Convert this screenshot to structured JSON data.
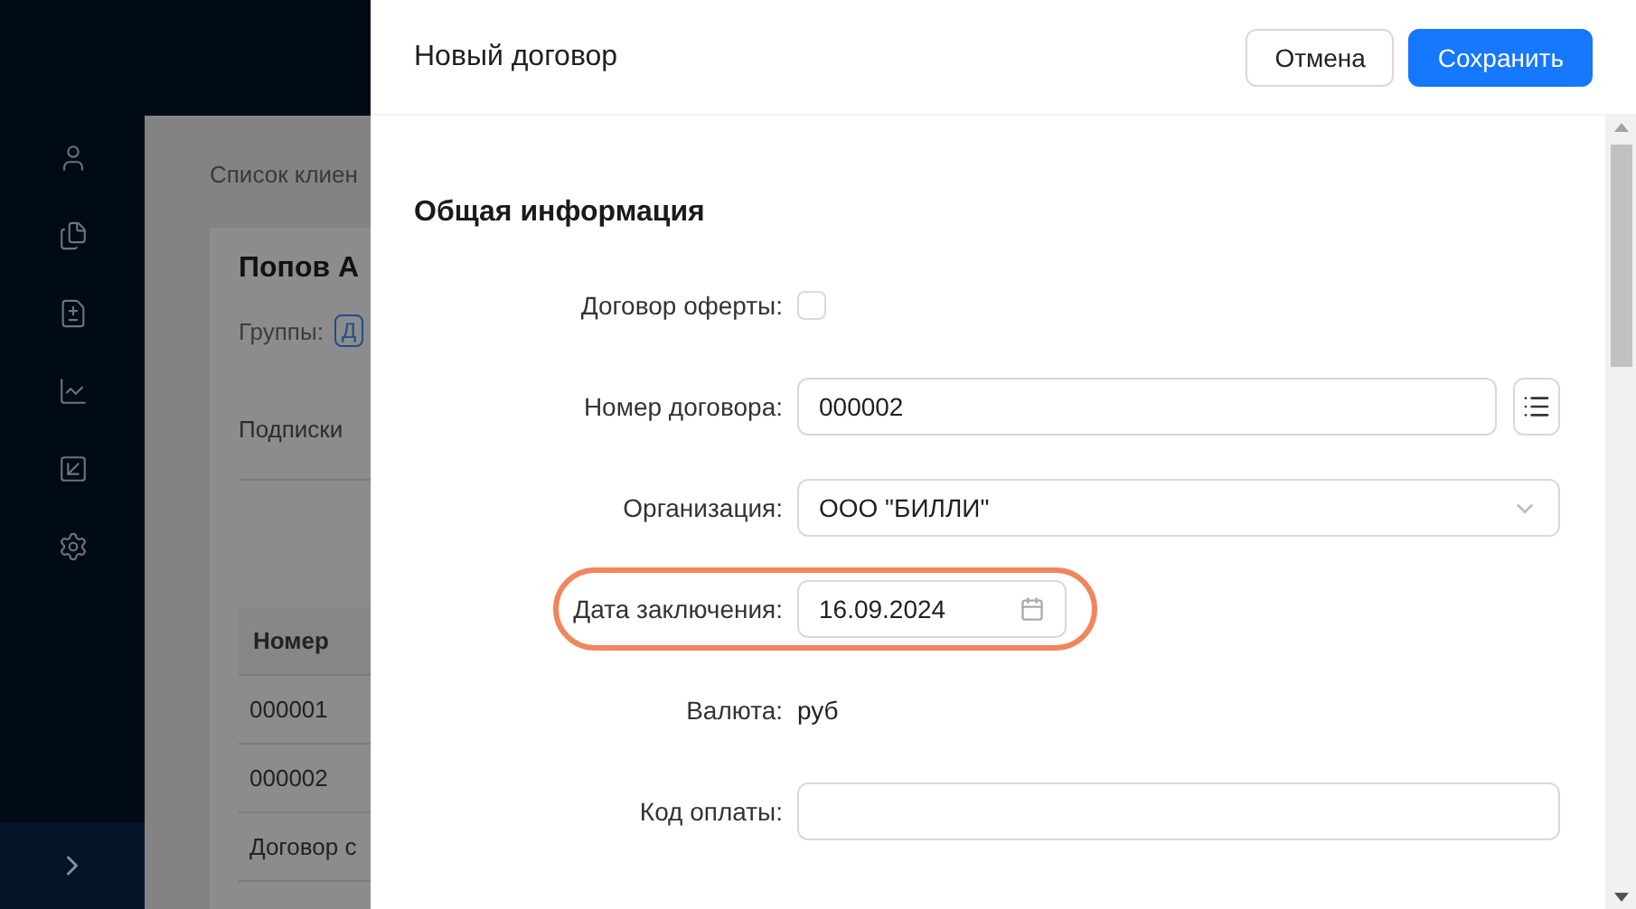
{
  "background": {
    "breadcrumb": "Список клиен",
    "heading": "Попов А",
    "groups_label": "Группы:",
    "group_tag": "Д",
    "tab": "Подписки",
    "table": {
      "column_1": "Номер",
      "rows": [
        "000001",
        "000002",
        "Договор с"
      ]
    }
  },
  "drawer": {
    "title": "Новый договор",
    "buttons": [
      {
        "label": "Отмена",
        "kind": "default"
      },
      {
        "label": "Сохранить",
        "kind": "primary"
      }
    ],
    "section": "Общая информация",
    "fields": [
      {
        "kind": "checkbox",
        "label": "Договор оферты:",
        "checked": false
      },
      {
        "kind": "input_with_button",
        "label": "Номер договора:",
        "value": "000002"
      },
      {
        "kind": "select",
        "label": "Организация:",
        "value": "ООО \"БИЛЛИ\""
      },
      {
        "kind": "date",
        "label": "Дата заключения:",
        "value": "16.09.2024",
        "highlighted": true
      },
      {
        "kind": "text",
        "label": "Валюта:",
        "value": "руб"
      },
      {
        "kind": "input",
        "label": "Код оплаты:"
      }
    ]
  }
}
